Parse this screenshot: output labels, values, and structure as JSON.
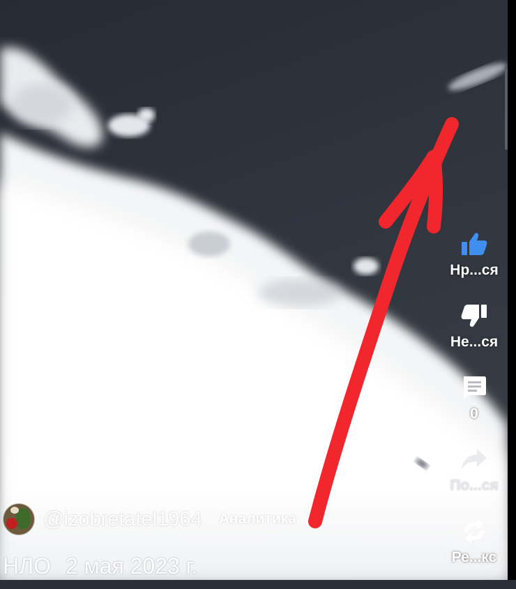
{
  "video": {
    "channel_handle": "@izobretatel1964",
    "analytics_label": "Аналитика",
    "title": "НЛО",
    "date": "2 мая 2023 г."
  },
  "actions": {
    "like_label": "Нр...ся",
    "dislike_label": "Не...ся",
    "comments_count": "0",
    "share_label": "По...ся",
    "remix_label": "Ре...кс"
  },
  "icons": {
    "like": "thumbs-up-icon",
    "dislike": "thumbs-down-icon",
    "comments": "comment-icon",
    "share": "share-arrow-icon",
    "remix": "remix-icon",
    "annotation": "red-arrow-annotation"
  },
  "colors": {
    "like_accent": "#3f8ef0",
    "annotation_red": "#f2262d",
    "sky": "#2c3139"
  }
}
